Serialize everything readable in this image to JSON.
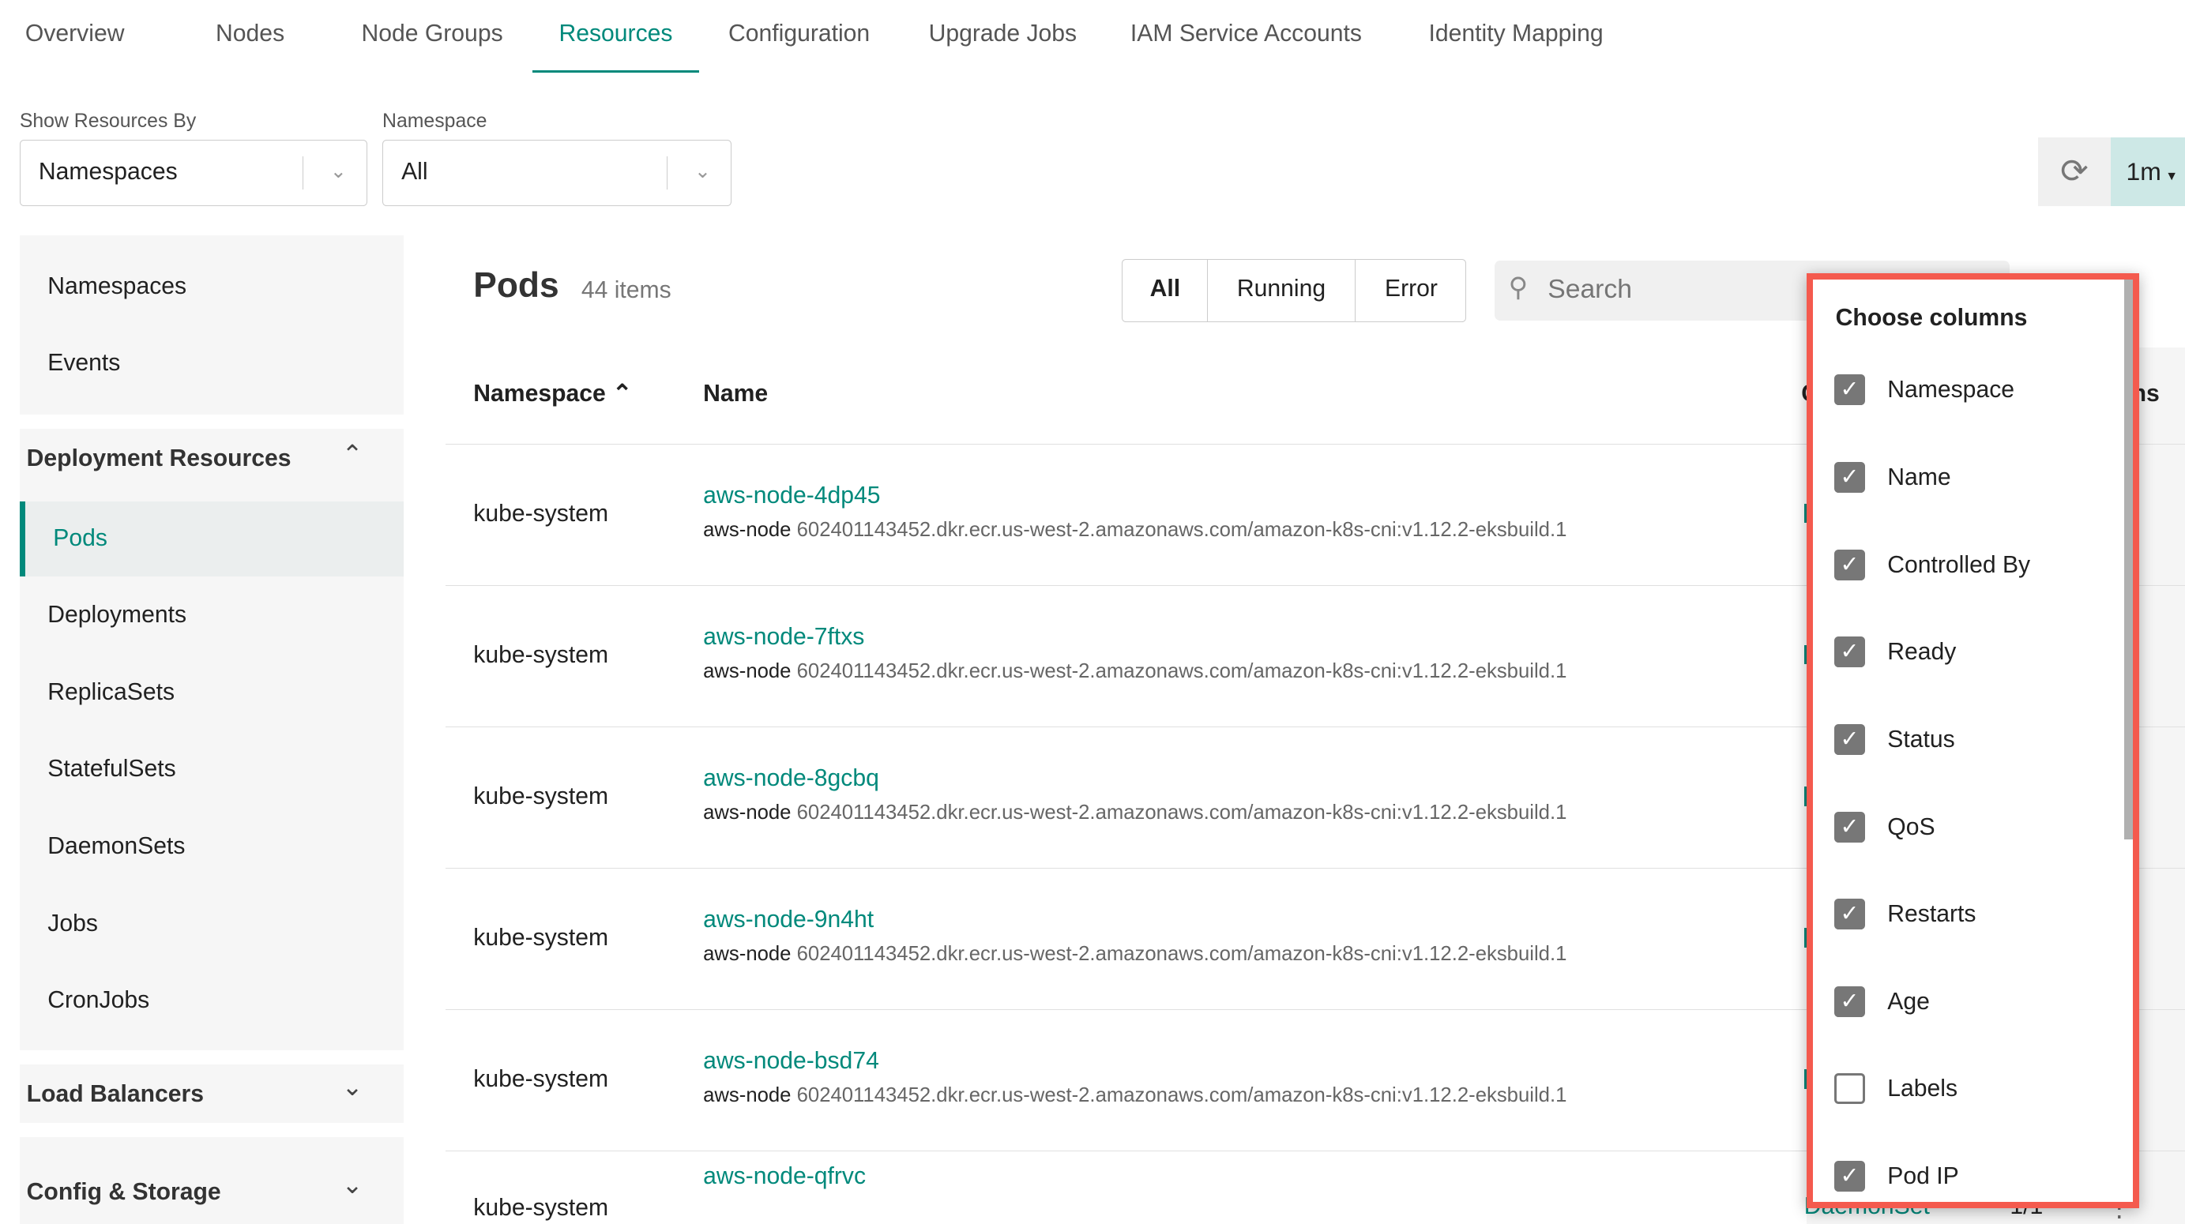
{
  "tabs": [
    {
      "label": "Overview"
    },
    {
      "label": "Nodes"
    },
    {
      "label": "Node Groups"
    },
    {
      "label": "Resources",
      "active": true
    },
    {
      "label": "Configuration"
    },
    {
      "label": "Upgrade Jobs"
    },
    {
      "label": "IAM Service Accounts"
    },
    {
      "label": "Identity Mapping"
    }
  ],
  "filters": {
    "show_by_label": "Show Resources By",
    "show_by_value": "Namespaces",
    "namespace_label": "Namespace",
    "namespace_value": "All"
  },
  "refresh": {
    "icon": "refresh-icon",
    "interval": "1m"
  },
  "sidebar": {
    "top": [
      "Namespaces",
      "Events"
    ],
    "deployment_header": "Deployment Resources",
    "deployment_items": [
      "Pods",
      "Deployments",
      "ReplicaSets",
      "StatefulSets",
      "DaemonSets",
      "Jobs",
      "CronJobs"
    ],
    "active": "Pods",
    "load_balancers": "Load Balancers",
    "config_storage": "Config & Storage"
  },
  "pods": {
    "title": "Pods",
    "count": "44 items",
    "filters": [
      "All",
      "Running",
      "Error"
    ],
    "active_filter": "All",
    "search_placeholder": "Search",
    "columns": {
      "namespace": "Namespace",
      "name": "Name",
      "partial_c": "C",
      "partial_ns": "ns"
    },
    "rows": [
      {
        "namespace": "kube-system",
        "name": "aws-node-4dp45",
        "container": "aws-node",
        "image": "602401143452.dkr.ecr.us-west-2.amazonaws.com/amazon-k8s-cni:v1.12.2-eksbuild.1"
      },
      {
        "namespace": "kube-system",
        "name": "aws-node-7ftxs",
        "container": "aws-node",
        "image": "602401143452.dkr.ecr.us-west-2.amazonaws.com/amazon-k8s-cni:v1.12.2-eksbuild.1"
      },
      {
        "namespace": "kube-system",
        "name": "aws-node-8gcbq",
        "container": "aws-node",
        "image": "602401143452.dkr.ecr.us-west-2.amazonaws.com/amazon-k8s-cni:v1.12.2-eksbuild.1"
      },
      {
        "namespace": "kube-system",
        "name": "aws-node-9n4ht",
        "container": "aws-node",
        "image": "602401143452.dkr.ecr.us-west-2.amazonaws.com/amazon-k8s-cni:v1.12.2-eksbuild.1"
      },
      {
        "namespace": "kube-system",
        "name": "aws-node-bsd74",
        "container": "aws-node",
        "image": "602401143452.dkr.ecr.us-west-2.amazonaws.com/amazon-k8s-cni:v1.12.2-eksbuild.1"
      },
      {
        "namespace": "kube-system",
        "name": "aws-node-qfrvc",
        "controlled_by": "DaemonSet",
        "ready": "1/1"
      }
    ]
  },
  "choose_columns": {
    "title": "Choose columns",
    "items": [
      {
        "label": "Namespace",
        "checked": true
      },
      {
        "label": "Name",
        "checked": true
      },
      {
        "label": "Controlled By",
        "checked": true
      },
      {
        "label": "Ready",
        "checked": true
      },
      {
        "label": "Status",
        "checked": true
      },
      {
        "label": "QoS",
        "checked": true
      },
      {
        "label": "Restarts",
        "checked": true
      },
      {
        "label": "Age",
        "checked": true
      },
      {
        "label": "Labels",
        "checked": false
      },
      {
        "label": "Pod IP",
        "checked": true
      }
    ]
  },
  "colors": {
    "accent": "#00897b",
    "highlight_border": "#f45a4e"
  }
}
